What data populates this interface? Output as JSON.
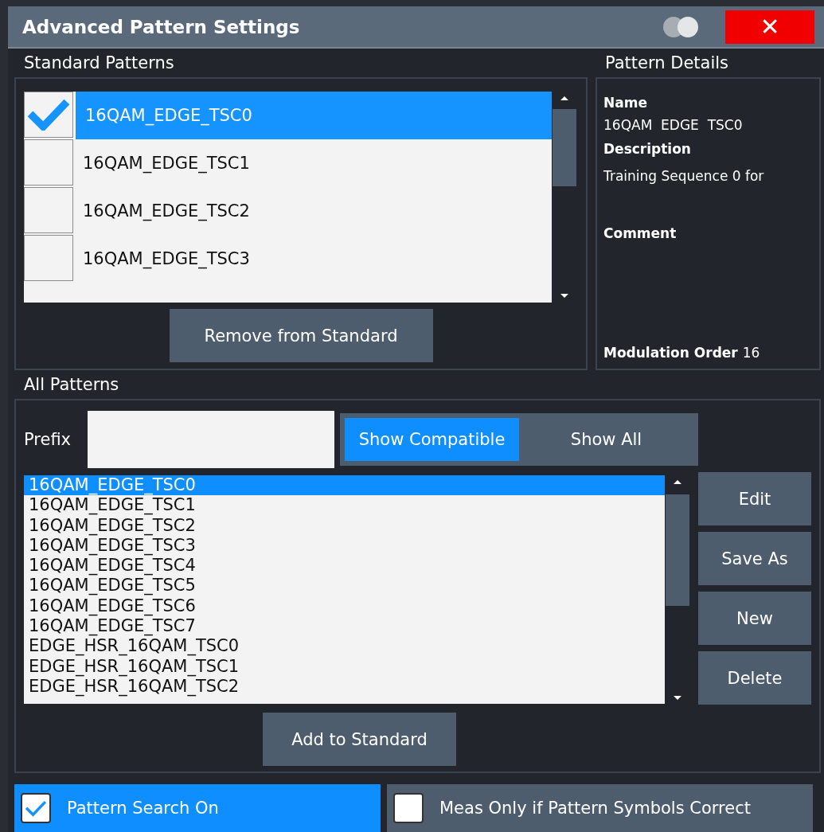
{
  "window": {
    "title": "Advanced Pattern Settings",
    "close_label": "✕"
  },
  "standard_patterns": {
    "title": "Standard Patterns",
    "items": [
      {
        "label": "16QAM_EDGE_TSC0",
        "checked": true,
        "selected": true
      },
      {
        "label": "16QAM_EDGE_TSC1",
        "checked": false,
        "selected": false
      },
      {
        "label": "16QAM_EDGE_TSC2",
        "checked": false,
        "selected": false
      },
      {
        "label": "16QAM_EDGE_TSC3",
        "checked": false,
        "selected": false
      }
    ],
    "button": "Remove from Standard"
  },
  "pattern_details": {
    "title": "Pattern Details",
    "name_label": "Name",
    "name": "16QAM  EDGE  TSC0",
    "description_label": "Description",
    "description": "Training Sequence 0 for",
    "comment_label": "Comment",
    "modulation_label": "Modulation Order",
    "modulation_value": "16"
  },
  "all_patterns": {
    "title": "All Patterns",
    "prefix_label": "Prefix",
    "filters": [
      {
        "label": "Show Compatible",
        "selected": true
      },
      {
        "label": "Show All",
        "selected": false
      }
    ],
    "items": [
      {
        "label": "16QAM_EDGE_TSC0",
        "selected": true
      },
      {
        "label": "16QAM_EDGE_TSC1",
        "selected": false
      },
      {
        "label": "16QAM_EDGE_TSC2",
        "selected": false
      },
      {
        "label": "16QAM_EDGE_TSC3",
        "selected": false
      },
      {
        "label": "16QAM_EDGE_TSC4",
        "selected": false
      },
      {
        "label": "16QAM_EDGE_TSC5",
        "selected": false
      },
      {
        "label": "16QAM_EDGE_TSC6",
        "selected": false
      },
      {
        "label": "16QAM_EDGE_TSC7",
        "selected": false
      },
      {
        "label": "EDGE_HSR_16QAM_TSC0",
        "selected": false
      },
      {
        "label": "EDGE_HSR_16QAM_TSC1",
        "selected": false
      },
      {
        "label": "EDGE_HSR_16QAM_TSC2",
        "selected": false
      }
    ],
    "actions": [
      "Edit",
      "Save As",
      "New",
      "Delete"
    ],
    "add_button": "Add to Standard"
  },
  "options": [
    {
      "label": "Pattern Search On",
      "checked": true
    },
    {
      "label": "Meas Only if Pattern Symbols Correct",
      "checked": false
    }
  ]
}
